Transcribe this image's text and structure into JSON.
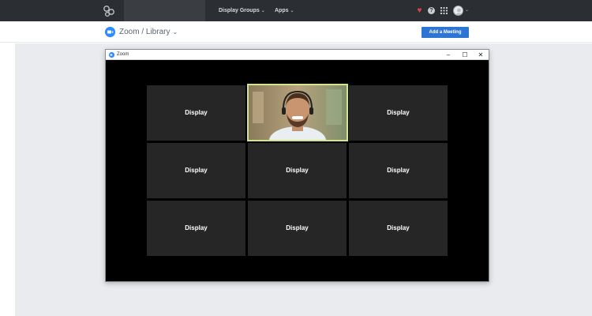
{
  "navbar": {
    "logo_icon": "flower-logo-icon",
    "items": [
      {
        "label": "Display Groups"
      },
      {
        "label": "Apps"
      }
    ],
    "icons": [
      "heart-icon",
      "help-icon",
      "grid-icon",
      "avatar-icon"
    ],
    "accent_heart": "#e0443e"
  },
  "breadcrumb": {
    "app_icon": "zoom-icon",
    "text": "Zoom / Library"
  },
  "actions": {
    "add_meeting_label": "Add a Meeting",
    "button_color": "#2d75d4"
  },
  "zoom_window": {
    "title": "Zoom",
    "controls": {
      "minimize": "–",
      "maximize": "☐",
      "close": "✕"
    },
    "tiles": [
      {
        "label": "Display",
        "type": "display"
      },
      {
        "label": "",
        "type": "video",
        "icon": "person-video"
      },
      {
        "label": "Display",
        "type": "display"
      },
      {
        "label": "Display",
        "type": "display"
      },
      {
        "label": "Display",
        "type": "display"
      },
      {
        "label": "Display",
        "type": "display"
      },
      {
        "label": "Display",
        "type": "display"
      },
      {
        "label": "Display",
        "type": "display"
      },
      {
        "label": "Display",
        "type": "display"
      }
    ],
    "active_tile_border": "#d7e38a"
  }
}
